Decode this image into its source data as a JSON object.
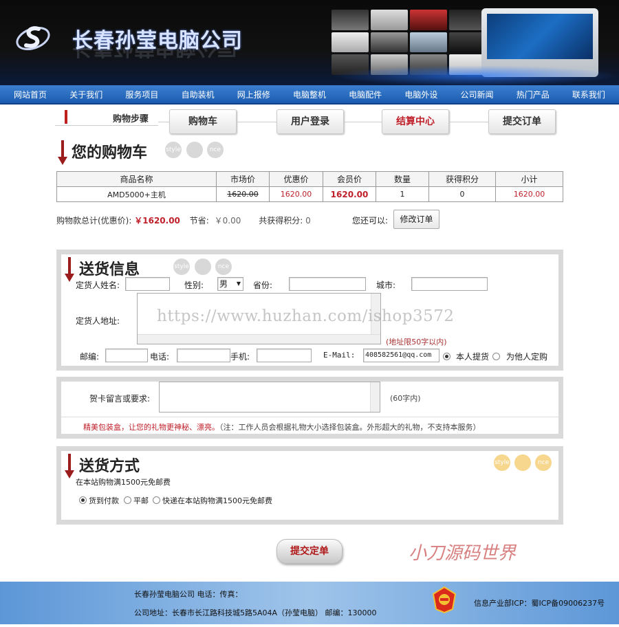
{
  "header": {
    "company_name": "长春孙莹电脑公司",
    "colors": {
      "nav": "#2a6bc0",
      "accent_red": "#c0202a"
    }
  },
  "nav": [
    "网站首页",
    "关于我们",
    "服务项目",
    "自助装机",
    "网上报修",
    "电脑整机",
    "电脑配件",
    "电脑外设",
    "公司新闻",
    "热门产品",
    "联系我们"
  ],
  "steps": {
    "label": "购物步骤",
    "items": [
      "购物车",
      "用户登录",
      "结算中心",
      "提交订单"
    ],
    "active_index": 2
  },
  "cart": {
    "title": "您的购物车",
    "columns": [
      "商品名称",
      "市场价",
      "优惠价",
      "会员价",
      "数量",
      "获得积分",
      "小计"
    ],
    "row": {
      "name": "AMD5000+主机",
      "market": "1620.00",
      "discount": "1620.00",
      "member": "1620.00",
      "qty": "1",
      "points": "0",
      "subtotal": "1620.00"
    },
    "totals": {
      "total_label": "购物款总计(优惠价):",
      "total_value": "￥1620.00",
      "save_label": "节省:",
      "save_value": "￥0.00",
      "points_label": "共获得积分:",
      "points_value": "0",
      "more_label": "您还可以:",
      "modify_button": "修改订单"
    }
  },
  "decor": [
    "style",
    "",
    "nce"
  ],
  "delivery": {
    "title": "送货信息",
    "name_label": "定货人姓名:",
    "gender_label": "性别:",
    "gender_value": "男",
    "province_label": "省份:",
    "city_label": "城市:",
    "address_label": "定货人地址:",
    "address_limit": "(地址限50字以内)",
    "zip_label": "邮编:",
    "phone_label": "电话:",
    "mobile_label": "手机:",
    "email_label": "E-Mail:",
    "email_value": "408582561@qq.com",
    "self_pickup": "本人提货",
    "for_other": "为他人定购"
  },
  "watermark": "https://www.huzhan.com/ishop3572",
  "card": {
    "label": "贺卡留言或要求:",
    "limit": "(60字内)",
    "notice_red": "精美包装盒，让您的礼物更神秘、漂亮。",
    "notice_gray": "（注：工作人员会根据礼物大小选择包装盒。外形超大的礼物，不支持本服务）"
  },
  "shipping": {
    "title": "送货方式",
    "free_note": "在本站购物满1500元免邮费",
    "options": [
      "货到付款",
      "平邮",
      "快递在本站购物满1500元免邮费"
    ],
    "selected_index": 0
  },
  "submit_button": "提交定单",
  "signature": "小刀源码世界",
  "footer": {
    "line1": "长春孙莹电脑公司 电话：传真：",
    "line2": "公司地址：长春市长江路科技城5路5A04A（孙莹电脑） 邮编：130000",
    "icp": "信息产业部ICP：蜀ICP备09006237号"
  }
}
